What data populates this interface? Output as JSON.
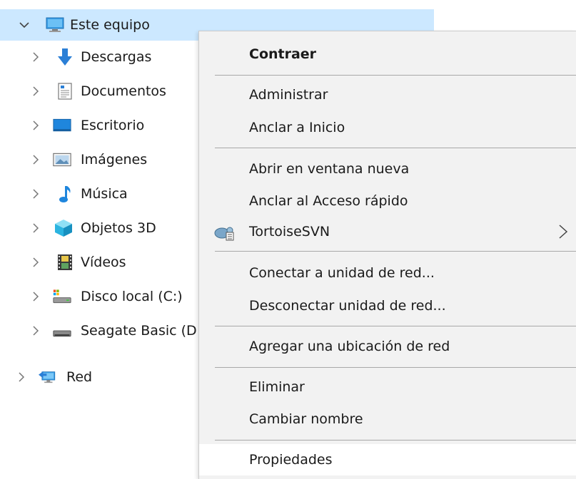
{
  "tree": {
    "root": {
      "label": "Este equipo",
      "expanded": true,
      "icon": "computer-icon"
    },
    "items": [
      {
        "label": "Descargas",
        "icon": "download-arrow-icon"
      },
      {
        "label": "Documentos",
        "icon": "document-icon"
      },
      {
        "label": "Escritorio",
        "icon": "desktop-icon"
      },
      {
        "label": "Imágenes",
        "icon": "pictures-icon"
      },
      {
        "label": "Música",
        "icon": "music-note-icon"
      },
      {
        "label": "Objetos 3D",
        "icon": "cube-3d-icon"
      },
      {
        "label": "Vídeos",
        "icon": "film-icon"
      },
      {
        "label": "Disco local (C:)",
        "icon": "local-disk-icon"
      },
      {
        "label": "Seagate Basic (D",
        "icon": "external-drive-icon"
      }
    ],
    "network": {
      "label": "Red",
      "icon": "network-icon"
    }
  },
  "context_menu": {
    "items": [
      {
        "label": "Contraer",
        "bold": true
      },
      {
        "label": "Administrar"
      },
      {
        "label": "Anclar a Inicio"
      },
      {
        "label": "Abrir en ventana nueva"
      },
      {
        "label": "Anclar al Acceso rápido"
      },
      {
        "label": "TortoiseSVN",
        "submenu": true,
        "icon": "tortoisesvn-icon"
      },
      {
        "label": "Conectar a unidad de red..."
      },
      {
        "label": "Desconectar unidad de red..."
      },
      {
        "label": "Agregar una ubicación de red"
      },
      {
        "label": "Eliminar"
      },
      {
        "label": "Cambiar nombre"
      },
      {
        "label": "Propiedades",
        "hovered": true
      }
    ]
  },
  "colors": {
    "selection": "#cce8ff",
    "menu_bg": "#f2f2f2",
    "hover_bg": "#ffffff",
    "separator": "#a8a8a8"
  }
}
